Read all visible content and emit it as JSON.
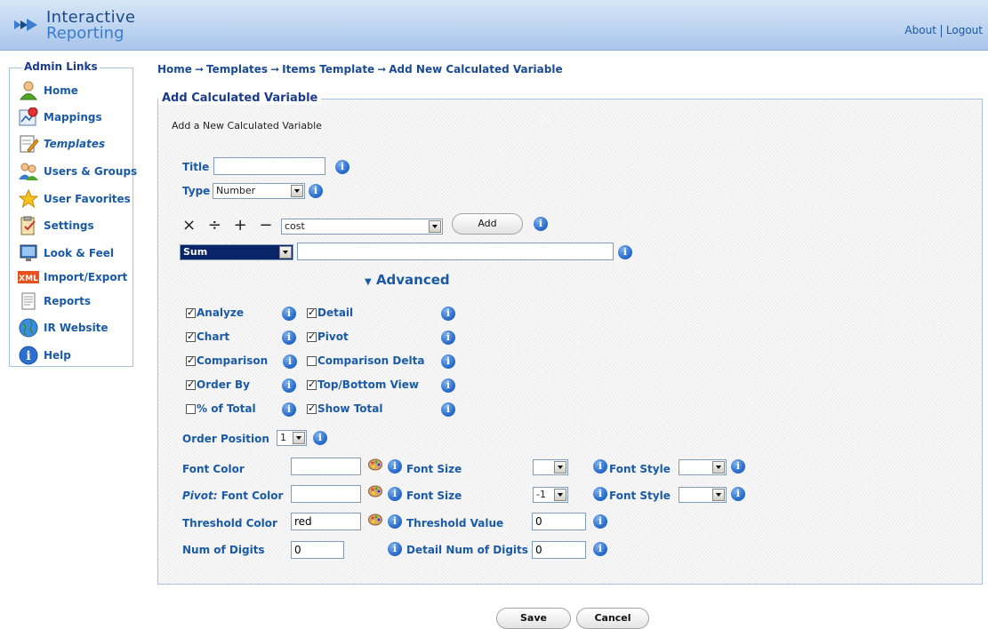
{
  "header": {
    "logo_line1": "Interactive",
    "logo_line2": "Reporting",
    "about": "About",
    "logout": "Logout"
  },
  "sidebar": {
    "title": "Admin Links",
    "items": [
      {
        "label": "Home",
        "icon": "home-user-icon"
      },
      {
        "label": "Mappings",
        "icon": "mappings-icon"
      },
      {
        "label": "Templates",
        "icon": "templates-icon"
      },
      {
        "label": "Users & Groups",
        "icon": "users-groups-icon"
      },
      {
        "label": "User Favorites",
        "icon": "star-icon"
      },
      {
        "label": "Settings",
        "icon": "settings-icon"
      },
      {
        "label": "Look & Feel",
        "icon": "monitor-icon"
      },
      {
        "label": "Import/Export",
        "icon": "xml-icon"
      },
      {
        "label": "Reports",
        "icon": "report-icon"
      },
      {
        "label": "IR Website",
        "icon": "globe-icon"
      },
      {
        "label": "Help",
        "icon": "help-icon"
      }
    ]
  },
  "breadcrumb": [
    "Home",
    "Templates",
    "Items Template",
    "Add New Calculated Variable"
  ],
  "panel": {
    "legend": "Add Calculated Variable",
    "subtitle": "Add a New Calculated Variable"
  },
  "form": {
    "title_label": "Title",
    "title_value": "",
    "type_label": "Type",
    "type_value": "Number",
    "ops": "× ÷ + −",
    "field_value": "cost",
    "add_label": "Add",
    "agg_value": "Sum",
    "expression_value": "",
    "advanced_label": "Advanced",
    "checks": [
      {
        "label": "Analyze",
        "checked": true
      },
      {
        "label": "Detail",
        "checked": true
      },
      {
        "label": "Chart",
        "checked": true
      },
      {
        "label": "Pivot",
        "checked": true
      },
      {
        "label": "Comparison",
        "checked": true
      },
      {
        "label": "Comparison Delta",
        "checked": false
      },
      {
        "label": "Order By",
        "checked": true
      },
      {
        "label": "Top/Bottom View",
        "checked": true
      },
      {
        "label": "% of Total",
        "checked": false
      },
      {
        "label": "Show Total",
        "checked": true
      }
    ],
    "order_position_label": "Order Position",
    "order_position_value": "1",
    "font_color_label": "Font Color",
    "font_color_value": "",
    "font_size_label": "Font Size",
    "font_size_value": "",
    "font_style_label": "Font Style",
    "font_style_value": "",
    "pivot_prefix": "Pivot:",
    "pivot_font_color_label": "Font Color",
    "pivot_font_color_value": "",
    "pivot_font_size_label": "Font Size",
    "pivot_font_size_value": "-1",
    "pivot_font_style_label": "Font Style",
    "pivot_font_style_value": "",
    "threshold_color_label": "Threshold Color",
    "threshold_color_value": "red",
    "threshold_value_label": "Threshold Value",
    "threshold_value_value": "0",
    "num_digits_label": "Num of Digits",
    "num_digits_value": "0",
    "detail_digits_label": "Detail Num of Digits",
    "detail_digits_value": "0"
  },
  "actions": {
    "save": "Save",
    "cancel": "Cancel"
  },
  "colors": {
    "link_blue": "#1a5aa6",
    "header_blue": "#a9c5ea",
    "border_blue": "#a8c4e4"
  }
}
